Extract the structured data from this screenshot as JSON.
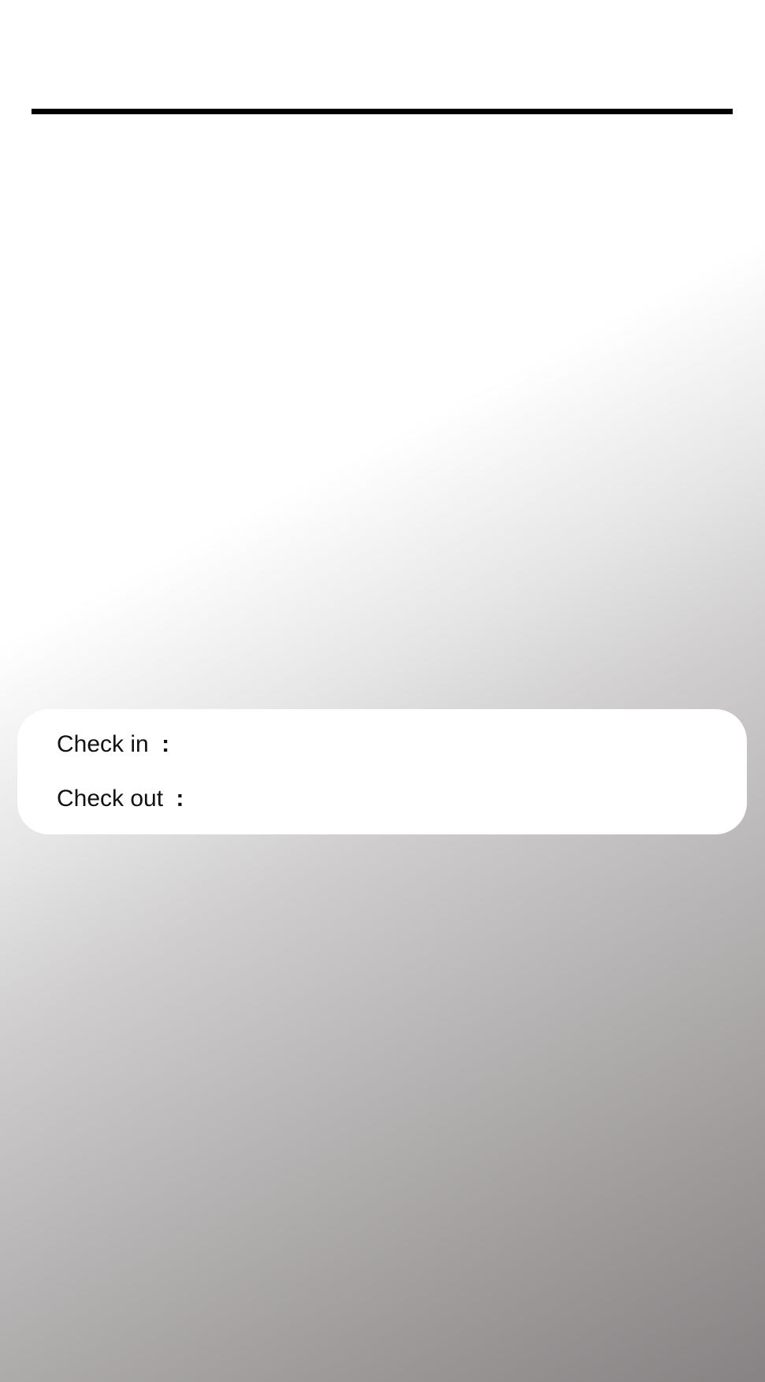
{
  "booking_card": {
    "check_in_label": "Check in",
    "check_in_separator": ":",
    "check_out_label": "Check out",
    "check_out_separator": ":"
  },
  "colors": {
    "divider": "#000000",
    "card_background": "#ffffff",
    "text": "#111111",
    "background_gradient_start": "#ffffff",
    "background_gradient_end": "#878283"
  }
}
